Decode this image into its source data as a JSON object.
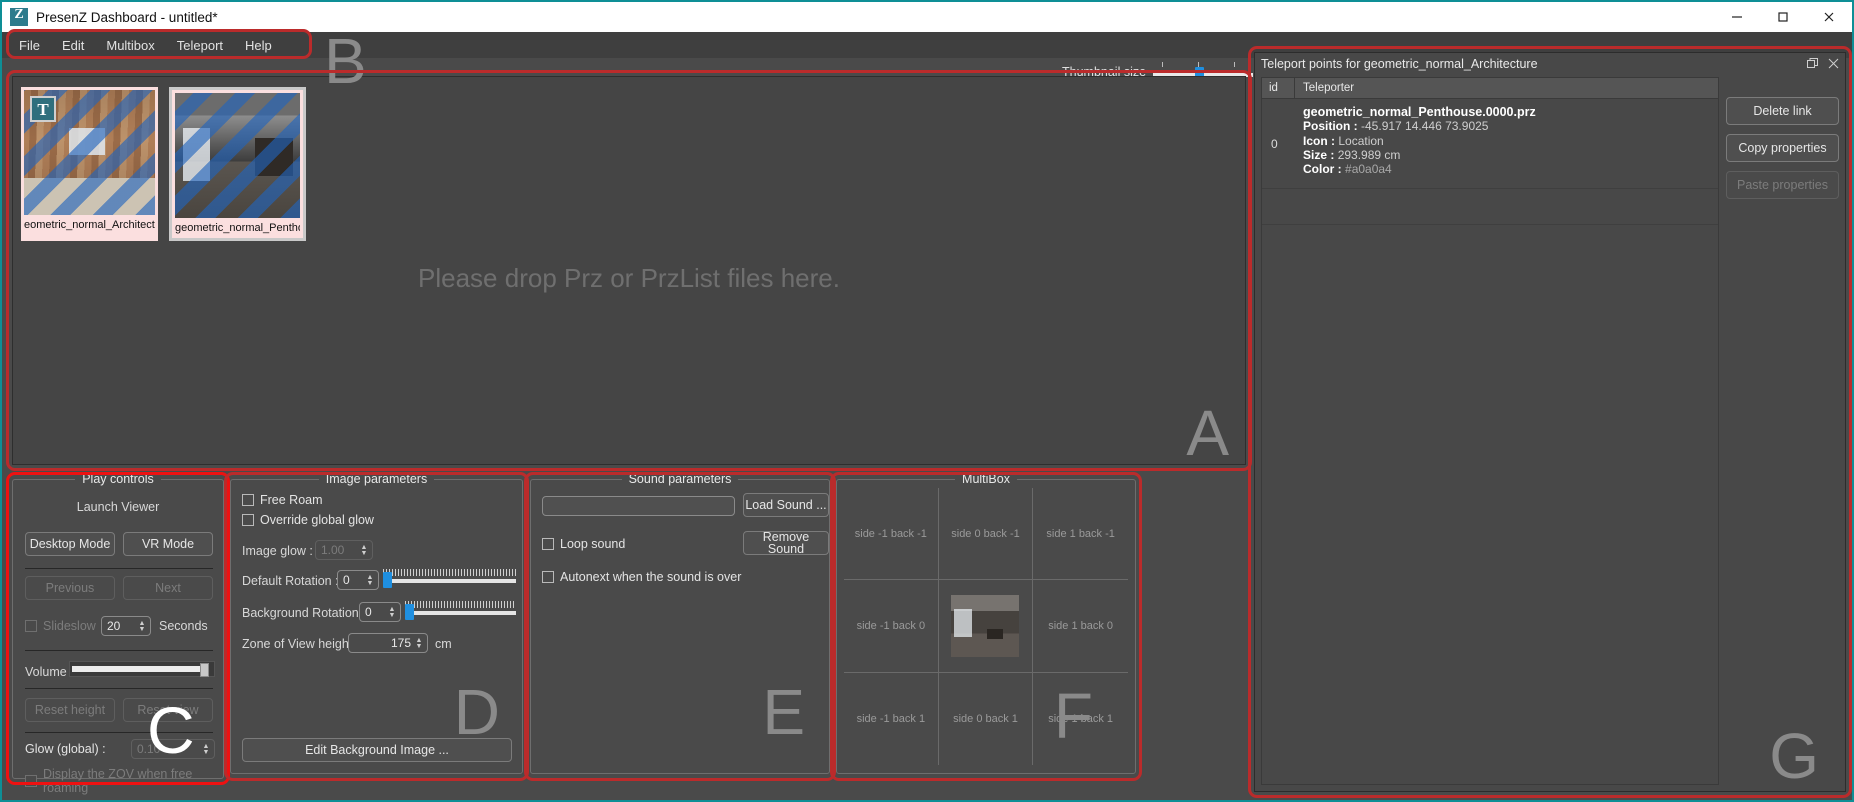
{
  "window": {
    "title": "PresenZ Dashboard - untitled*",
    "logo_letter": "Z",
    "minimize": "minimize-icon",
    "maximize": "maximize-icon",
    "close": "close-icon"
  },
  "menu": {
    "items": [
      "File",
      "Edit",
      "Multibox",
      "Teleport",
      "Help"
    ]
  },
  "annotations": {
    "a": "A",
    "b": "B",
    "c": "C",
    "d": "D",
    "e": "E",
    "f": "F",
    "g": "G"
  },
  "thumbnail_size": {
    "label": "Thumbnail size",
    "value": 50
  },
  "image_list": {
    "drop_hint": "Please drop Prz or PrzList files here.",
    "items": [
      {
        "name": "eometric_normal_Architectur",
        "badge": "T",
        "selected": false
      },
      {
        "name": "geometric_normal_Penthouse",
        "badge": "",
        "selected": true
      }
    ]
  },
  "play_controls": {
    "legend": "Play controls",
    "launch_viewer": "Launch Viewer",
    "desktop_mode": "Desktop Mode",
    "vr_mode": "VR Mode",
    "previous": "Previous",
    "next": "Next",
    "slideshow": "Slideslow",
    "slideshow_seconds": "20",
    "seconds_label": "Seconds",
    "volume": "Volume",
    "volume_value": 93,
    "reset_height": "Reset height",
    "reset_view": "Reset view",
    "glow_global": "Glow (global) :",
    "glow_value": "0.10",
    "display_zov": "Display the ZOV when free roaming"
  },
  "image_parameters": {
    "legend": "Image parameters",
    "free_roam": "Free Roam",
    "override_global_glow": "Override global glow",
    "image_glow_label": "Image glow :",
    "image_glow_value": "1.00",
    "default_rotation_label": "Default Rotation :",
    "default_rotation_value": "0",
    "background_rotation_label": "Background Rotation :",
    "background_rotation_value": "0",
    "zov_height_label": "Zone of View height :",
    "zov_height_value": "175",
    "zov_unit": "cm",
    "edit_background_image": "Edit Background Image ..."
  },
  "sound_parameters": {
    "legend": "Sound parameters",
    "sound_path_value": "",
    "load_sound": "Load Sound ...",
    "remove_sound": "Remove Sound",
    "loop_sound": "Loop sound",
    "autonext": "Autonext when the sound is over"
  },
  "multibox": {
    "legend": "MultiBox",
    "cells": [
      "side -1 back -1",
      "side 0 back -1",
      "side 1 back -1",
      "side -1 back 0",
      "",
      "side 1 back 0",
      "side -1 back 1",
      "side 0 back 1",
      "side 1 back 1"
    ],
    "active_index": 4
  },
  "teleport_dock": {
    "title": "Teleport points for geometric_normal_Architecture",
    "float_icon": "float-window-icon",
    "close_icon": "close-icon",
    "columns": [
      "id",
      "Teleporter"
    ],
    "rows": [
      {
        "id": "0",
        "file": "geometric_normal_Penthouse.0000.prz",
        "position_label": "Position :",
        "position_value": "-45.917 14.446 73.9025",
        "icon_label": "Icon :",
        "icon_value": "Location",
        "size_label": "Size :",
        "size_value": "293.989 cm",
        "color_label": "Color :",
        "color_value": "#a0a0a4"
      }
    ],
    "buttons": [
      {
        "label": "Delete link",
        "disabled": false
      },
      {
        "label": "Copy properties",
        "disabled": false
      },
      {
        "label": "Paste properties",
        "disabled": true
      }
    ]
  },
  "colors": {
    "accent": "#1f8fe0",
    "annotation_red": "#bb2b2b",
    "annotation_red_bright": "#ee1111",
    "window_border": "#0e8f96",
    "panel_bg": "#4a4a4a"
  }
}
